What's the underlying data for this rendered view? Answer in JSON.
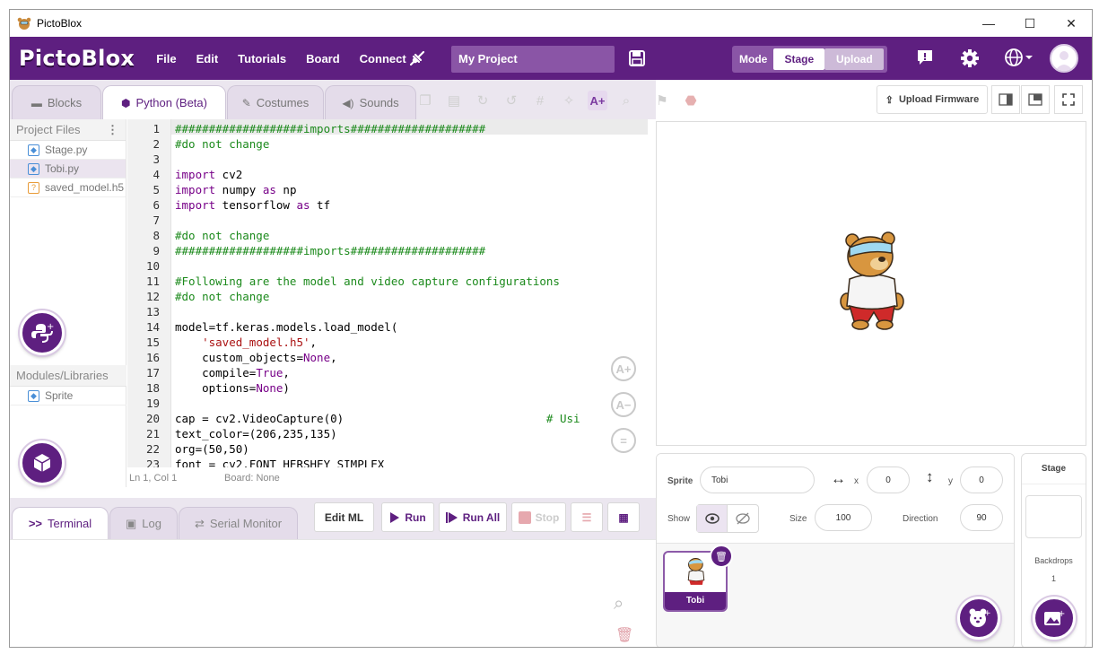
{
  "window": {
    "title": "PictoBlox",
    "minimize": "—",
    "maximize": "☐",
    "close": "✕"
  },
  "menubar": {
    "logo": "PictoBlox",
    "items": [
      "File",
      "Edit",
      "Tutorials",
      "Board",
      "Connect"
    ],
    "project_name": "My Project",
    "mode_label": "Mode",
    "mode_stage": "Stage",
    "mode_upload": "Upload"
  },
  "tabs": [
    "Blocks",
    "Python (Beta)",
    "Costumes",
    "Sounds"
  ],
  "upload_firmware": "Upload Firmware",
  "files": {
    "header": "Project Files",
    "items": [
      "Stage.py",
      "Tobi.py",
      "saved_model.h5"
    ],
    "modules_header": "Modules/Libraries",
    "modules": [
      "Sprite"
    ]
  },
  "editor": {
    "line_numbers": [
      "1",
      "2",
      "3",
      "4",
      "5",
      "6",
      "7",
      "8",
      "9",
      "10",
      "11",
      "12",
      "13",
      "14",
      "15",
      "16",
      "17",
      "18",
      "19",
      "20",
      "21",
      "22",
      "23"
    ],
    "status_line": "Ln 1, Col 1",
    "status_board": "Board: None"
  },
  "bottom": {
    "tabs": [
      "Terminal",
      "Log",
      "Serial Monitor"
    ],
    "edit_ml": "Edit ML",
    "run": "Run",
    "run_all": "Run All",
    "stop": "Stop"
  },
  "sprite": {
    "sprite_label": "Sprite",
    "name": "Tobi",
    "x_label": "x",
    "x": "0",
    "y_label": "y",
    "y": "0",
    "show_label": "Show",
    "size_label": "Size",
    "size": "100",
    "direction_label": "Direction",
    "direction": "90",
    "thumb_name": "Tobi"
  },
  "stage_panel": {
    "header": "Stage",
    "backdrops_label": "Backdrops",
    "backdrops_count": "1"
  },
  "colors": {
    "brand": "#5e1f80",
    "brand_light": "#8a55a6"
  }
}
